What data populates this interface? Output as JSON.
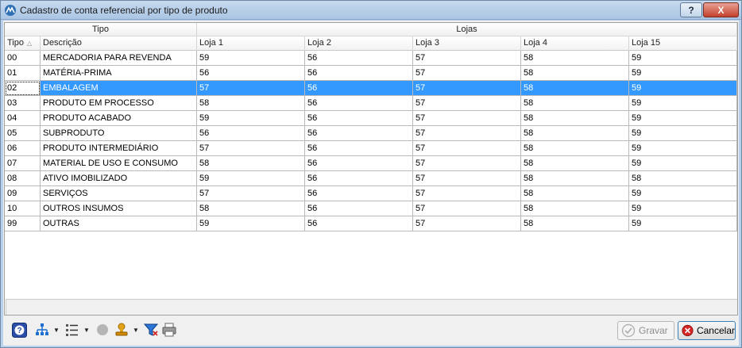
{
  "window": {
    "title": "Cadastro de conta referencial por tipo de produto",
    "help_label": "?",
    "close_label": "X"
  },
  "grid": {
    "bands": {
      "tipo": "Tipo",
      "lojas": "Lojas"
    },
    "columns": [
      "Tipo",
      "Descrição",
      "Loja 1",
      "Loja 2",
      "Loja 3",
      "Loja 4",
      "Loja 15"
    ],
    "sort_indicator": "△",
    "selected_row": 2,
    "rows": [
      [
        "00",
        "MERCADORIA PARA REVENDA",
        "59",
        "56",
        "57",
        "58",
        "59"
      ],
      [
        "01",
        "MATÉRIA-PRIMA",
        "56",
        "56",
        "57",
        "58",
        "59"
      ],
      [
        "02",
        "EMBALAGEM",
        "57",
        "56",
        "57",
        "58",
        "59"
      ],
      [
        "03",
        "PRODUTO EM PROCESSO",
        "58",
        "56",
        "57",
        "58",
        "59"
      ],
      [
        "04",
        "PRODUTO ACABADO",
        "59",
        "56",
        "57",
        "58",
        "59"
      ],
      [
        "05",
        "SUBPRODUTO",
        "56",
        "56",
        "57",
        "58",
        "59"
      ],
      [
        "06",
        "PRODUTO INTERMEDIÁRIO",
        "57",
        "56",
        "57",
        "58",
        "59"
      ],
      [
        "07",
        "MATERIAL DE USO E CONSUMO",
        "58",
        "56",
        "57",
        "58",
        "59"
      ],
      [
        "08",
        "ATIVO IMOBILIZADO",
        "59",
        "56",
        "57",
        "58",
        "58"
      ],
      [
        "09",
        "SERVIÇOS",
        "57",
        "56",
        "57",
        "58",
        "59"
      ],
      [
        "10",
        "OUTROS INSUMOS",
        "58",
        "56",
        "57",
        "58",
        "59"
      ],
      [
        "99",
        "OUTRAS",
        "59",
        "56",
        "57",
        "58",
        "59"
      ]
    ]
  },
  "toolbar": {
    "icons": [
      "help-icon",
      "hierarchy-icon",
      "list-options-icon",
      "record-icon",
      "stamp-icon",
      "filter-icon",
      "print-icon"
    ],
    "gravar_label": "Gravar",
    "cancelar_label": "Cancelar"
  },
  "colors": {
    "selection": "#3399ff",
    "titlebar": "#b9d1ea"
  }
}
